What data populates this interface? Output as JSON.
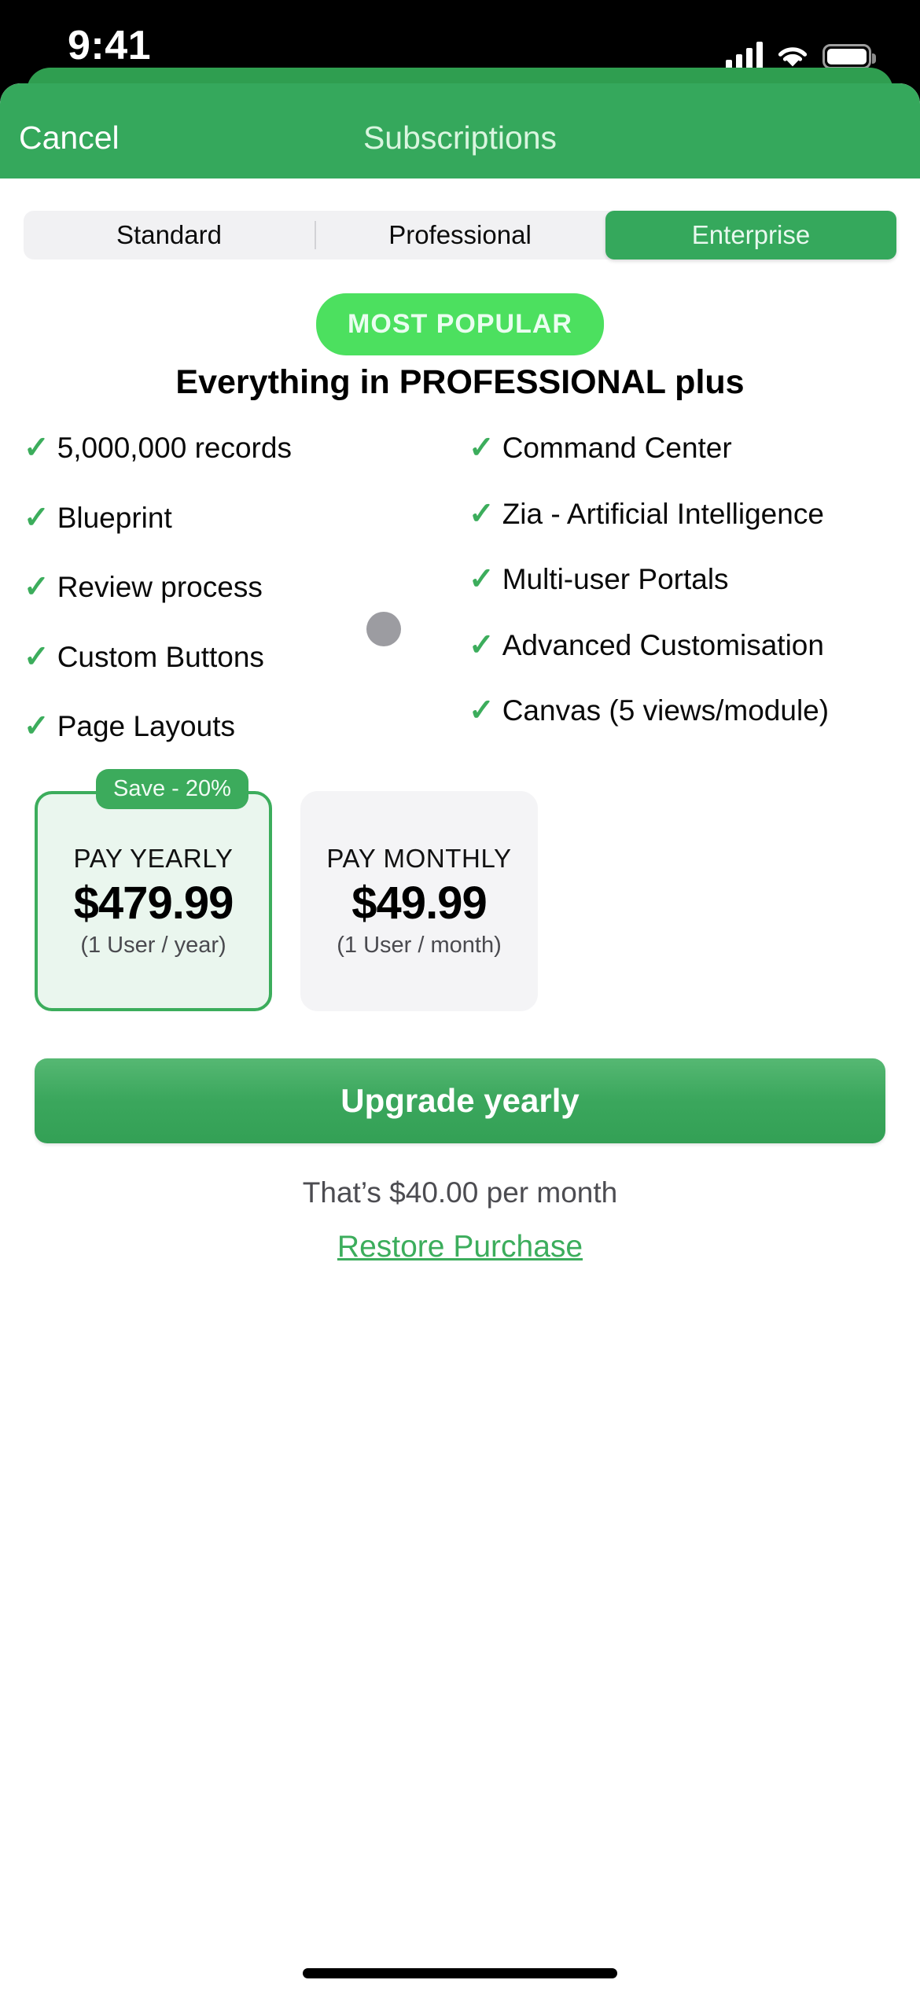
{
  "status_bar": {
    "time": "9:41",
    "cellular_icon": "cellular-bars-icon",
    "wifi_icon": "wifi-icon",
    "battery_icon": "battery-icon"
  },
  "nav": {
    "cancel_label": "Cancel",
    "title": "Subscriptions"
  },
  "segmented_control": {
    "options": [
      {
        "label": "Standard",
        "selected": false
      },
      {
        "label": "Professional",
        "selected": false
      },
      {
        "label": "Enterprise",
        "selected": true
      }
    ],
    "selected": "Enterprise"
  },
  "badge": {
    "most_popular": "MOST POPULAR"
  },
  "plan": {
    "heading": "Everything in PROFESSIONAL plus",
    "features_left": [
      "5,000,000 records",
      "Blueprint",
      "Review process",
      "Custom Buttons",
      "Page Layouts"
    ],
    "features_right": [
      "Command Center",
      "Zia - Artificial Intelligence",
      "Multi-user Portals",
      "Advanced Customisation",
      "Canvas (5 views/module)"
    ],
    "tick": "✓"
  },
  "pricing": {
    "yearly": {
      "save_badge": "Save - 20%",
      "label": "PAY YEARLY",
      "price": "$479.99",
      "sub": "(1 User / year)",
      "selected": true
    },
    "monthly": {
      "label": "PAY MONTHLY",
      "price": "$49.99",
      "sub": "(1 User / month)",
      "selected": false
    }
  },
  "footer": {
    "upgrade_label": "Upgrade yearly",
    "per_month_note": "That’s $40.00 per month",
    "restore_label": "Restore Purchase"
  },
  "colors": {
    "brand_green": "#35a85c",
    "badge_green": "#4ce05f",
    "card_green_bg": "#eaf6ee",
    "card_gray_bg": "#f4f4f6"
  }
}
